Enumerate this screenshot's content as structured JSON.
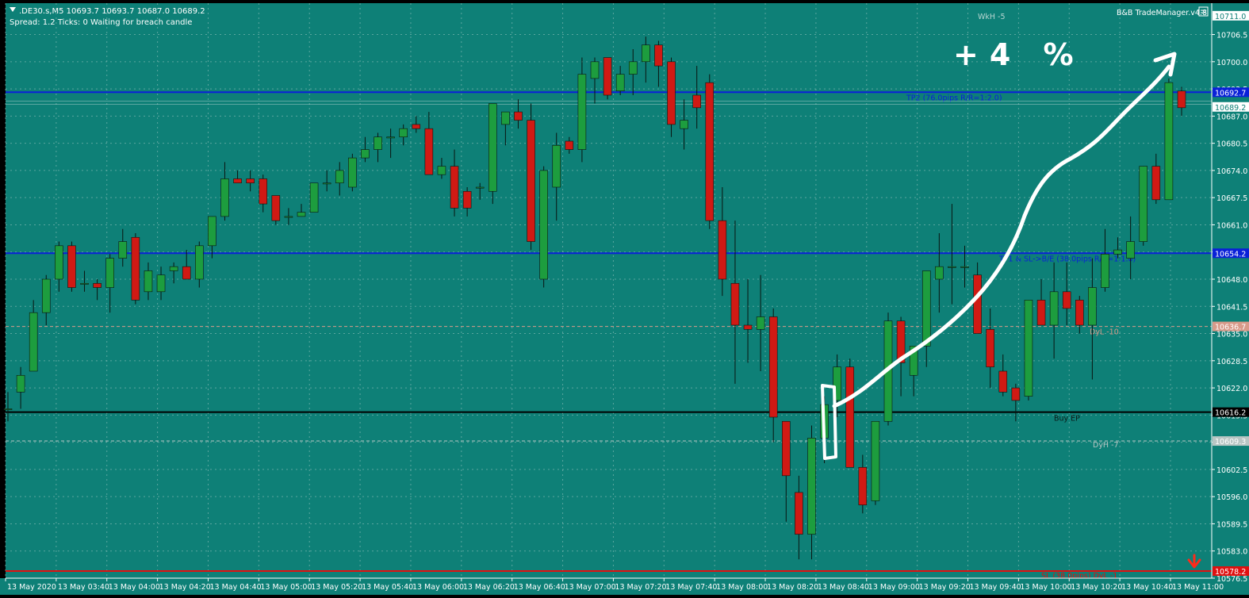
{
  "header": {
    "symbol_line": ".DE30.s,M5  10693.7 10693.7 10687.0 10689.2",
    "status_line": "Spread: 1.2  Ticks: 0  Waiting for breach candle",
    "trade_manager": "B&B TradeManager.v4.8"
  },
  "annotation": {
    "handwritten_text": "+4 %"
  },
  "colors": {
    "background": "#0e8077",
    "bull_body": "#1d9d3e",
    "bear_body": "#d01a14",
    "wick": "#0a1410",
    "tp_line": "#0a20d8",
    "sl_line": "#e01010",
    "entry_line": "#000000",
    "dyl_line": "#d89a8a",
    "dyh_line": "#b8c6c4",
    "grid": "#6fb0aa",
    "axis_text": "#ffffff"
  },
  "chart_data": {
    "type": "candlestick",
    "symbol": ".DE30.s",
    "timeframe": "M5",
    "ylim": [
      10576.5,
      10714
    ],
    "y_ticks": [
      "10706.5",
      "10700.0",
      "10693.5",
      "10687.0",
      "10680.5",
      "10674.0",
      "10667.5",
      "10661.0",
      "10654.5",
      "10648.0",
      "10641.5",
      "10635.0",
      "10628.5",
      "10622.0",
      "10615.5",
      "10609.0",
      "10602.5",
      "10596.0",
      "10589.5",
      "10583.0",
      "10576.5"
    ],
    "x_ticks": [
      "13 May 2020",
      "13 May 03:40",
      "13 May 04:00",
      "13 May 04:20",
      "13 May 04:40",
      "13 May 05:00",
      "13 May 05:20",
      "13 May 05:40",
      "13 May 06:00",
      "13 May 06:20",
      "13 May 06:40",
      "13 May 07:00",
      "13 May 07:20",
      "13 May 07:40",
      "13 May 08:00",
      "13 May 08:20",
      "13 May 08:40",
      "13 May 09:00",
      "13 May 09:20",
      "13 May 09:40",
      "13 May 10:00",
      "13 May 10:20",
      "13 May 10:40",
      "13 May 11:00"
    ],
    "price_tags": [
      {
        "value": "10711.0",
        "price": 10711.0,
        "color": "#ffffff",
        "text_color": "#0e8077"
      },
      {
        "value": "10692.7",
        "price": 10692.7,
        "color": "#0a20d8",
        "text_color": "#ffffff"
      },
      {
        "value": "10689.2",
        "price": 10689.2,
        "color": "#ffffff",
        "text_color": "#0e8077"
      },
      {
        "value": "10654.2",
        "price": 10654.2,
        "color": "#0a20d8",
        "text_color": "#ffffff"
      },
      {
        "value": "10636.7",
        "price": 10636.7,
        "color": "#d89a8a",
        "text_color": "#ffffff"
      },
      {
        "value": "10616.2",
        "price": 10616.2,
        "color": "#000000",
        "text_color": "#ffffff"
      },
      {
        "value": "10609.3",
        "price": 10609.3,
        "color": "#b8c6c4",
        "text_color": "#ffffff"
      },
      {
        "value": "10578.2",
        "price": 10578.2,
        "color": "#e01010",
        "text_color": "#ffffff"
      }
    ],
    "levels": [
      {
        "name": "tp2",
        "price": 10692.7,
        "style": "solid",
        "color": "#0a20d8",
        "label": "TP2 (76.0pips R/R=1:2.0)"
      },
      {
        "name": "tp1",
        "price": 10654.2,
        "style": "solid",
        "color": "#0a20d8",
        "label": "TP1 & SL->B/E (38.0pips R/R=1:1.0)"
      },
      {
        "name": "dyl",
        "price": 10636.7,
        "style": "dashed",
        "color": "#d89a8a",
        "label": "DyL -10"
      },
      {
        "name": "entry",
        "price": 10616.2,
        "style": "solid",
        "color": "#000000",
        "label": "Buy EP"
      },
      {
        "name": "dyh",
        "price": 10609.3,
        "style": "dashed",
        "color": "#b8c6c4",
        "label": "DyH -7"
      },
      {
        "name": "sl",
        "price": 10578.2,
        "style": "solid",
        "color": "#e01010",
        "label": "SL (38.0pips) DyL -1"
      },
      {
        "name": "wkh",
        "price": 10711.0,
        "style": "none",
        "color": "#b8d6d2",
        "label": "WkH -5"
      }
    ],
    "candles": [
      {
        "o": 10617,
        "h": 10621,
        "l": 10614,
        "c": 10617
      },
      {
        "o": 10621,
        "h": 10627,
        "l": 10617,
        "c": 10625
      },
      {
        "o": 10626,
        "h": 10643,
        "l": 10626,
        "c": 10640
      },
      {
        "o": 10640,
        "h": 10649,
        "l": 10637,
        "c": 10648
      },
      {
        "o": 10648,
        "h": 10657,
        "l": 10645,
        "c": 10656
      },
      {
        "o": 10656,
        "h": 10657,
        "l": 10645,
        "c": 10646
      },
      {
        "o": 10647,
        "h": 10650,
        "l": 10645,
        "c": 10647
      },
      {
        "o": 10647,
        "h": 10648,
        "l": 10643,
        "c": 10646
      },
      {
        "o": 10646,
        "h": 10654,
        "l": 10640,
        "c": 10653
      },
      {
        "o": 10653,
        "h": 10660,
        "l": 10651,
        "c": 10657
      },
      {
        "o": 10658,
        "h": 10659,
        "l": 10642,
        "c": 10643
      },
      {
        "o": 10645,
        "h": 10652,
        "l": 10643,
        "c": 10650
      },
      {
        "o": 10645,
        "h": 10651,
        "l": 10643,
        "c": 10649
      },
      {
        "o": 10650,
        "h": 10652,
        "l": 10647,
        "c": 10651
      },
      {
        "o": 10651,
        "h": 10655,
        "l": 10649,
        "c": 10648
      },
      {
        "o": 10648,
        "h": 10657,
        "l": 10646,
        "c": 10656
      },
      {
        "o": 10656,
        "h": 10663,
        "l": 10653,
        "c": 10663
      },
      {
        "o": 10663,
        "h": 10676,
        "l": 10662,
        "c": 10672
      },
      {
        "o": 10672,
        "h": 10674,
        "l": 10671,
        "c": 10671
      },
      {
        "o": 10672,
        "h": 10674,
        "l": 10669,
        "c": 10671
      },
      {
        "o": 10672,
        "h": 10673,
        "l": 10664,
        "c": 10666
      },
      {
        "o": 10668,
        "h": 10668,
        "l": 10661,
        "c": 10662
      },
      {
        "o": 10663,
        "h": 10665,
        "l": 10661,
        "c": 10663
      },
      {
        "o": 10663,
        "h": 10666,
        "l": 10663,
        "c": 10664
      },
      {
        "o": 10664,
        "h": 10671,
        "l": 10664,
        "c": 10671
      },
      {
        "o": 10671,
        "h": 10674,
        "l": 10669,
        "c": 10671
      },
      {
        "o": 10671,
        "h": 10676,
        "l": 10668,
        "c": 10674
      },
      {
        "o": 10670,
        "h": 10678,
        "l": 10669,
        "c": 10677
      },
      {
        "o": 10677,
        "h": 10682,
        "l": 10676,
        "c": 10679
      },
      {
        "o": 10679,
        "h": 10683,
        "l": 10676,
        "c": 10682
      },
      {
        "o": 10682,
        "h": 10684,
        "l": 10677,
        "c": 10682
      },
      {
        "o": 10682,
        "h": 10685,
        "l": 10680,
        "c": 10684
      },
      {
        "o": 10685,
        "h": 10687,
        "l": 10683,
        "c": 10684
      },
      {
        "o": 10684,
        "h": 10688,
        "l": 10673,
        "c": 10673
      },
      {
        "o": 10673,
        "h": 10677,
        "l": 10672,
        "c": 10675
      },
      {
        "o": 10675,
        "h": 10679,
        "l": 10663,
        "c": 10665
      },
      {
        "o": 10669,
        "h": 10670,
        "l": 10663,
        "c": 10665
      },
      {
        "o": 10670,
        "h": 10671,
        "l": 10667,
        "c": 10670
      },
      {
        "o": 10669,
        "h": 10690,
        "l": 10666,
        "c": 10690
      },
      {
        "o": 10685,
        "h": 10688,
        "l": 10680,
        "c": 10688
      },
      {
        "o": 10688,
        "h": 10691,
        "l": 10684,
        "c": 10686
      },
      {
        "o": 10686,
        "h": 10690,
        "l": 10655,
        "c": 10657
      },
      {
        "o": 10648,
        "h": 10675,
        "l": 10646,
        "c": 10674
      },
      {
        "o": 10670,
        "h": 10683,
        "l": 10662,
        "c": 10680
      },
      {
        "o": 10681,
        "h": 10682,
        "l": 10678,
        "c": 10679
      },
      {
        "o": 10679,
        "h": 10701,
        "l": 10676,
        "c": 10697
      },
      {
        "o": 10696,
        "h": 10701,
        "l": 10690,
        "c": 10700
      },
      {
        "o": 10701,
        "h": 10701,
        "l": 10691,
        "c": 10692
      },
      {
        "o": 10693,
        "h": 10699,
        "l": 10692,
        "c": 10697
      },
      {
        "o": 10697,
        "h": 10703,
        "l": 10692,
        "c": 10700
      },
      {
        "o": 10700,
        "h": 10706,
        "l": 10695,
        "c": 10704
      },
      {
        "o": 10704,
        "h": 10705,
        "l": 10694,
        "c": 10699
      },
      {
        "o": 10700,
        "h": 10701,
        "l": 10682,
        "c": 10685
      },
      {
        "o": 10684,
        "h": 10691,
        "l": 10679,
        "c": 10686
      },
      {
        "o": 10692,
        "h": 10699,
        "l": 10684,
        "c": 10689
      },
      {
        "o": 10695,
        "h": 10697,
        "l": 10660,
        "c": 10662
      },
      {
        "o": 10662,
        "h": 10670,
        "l": 10644,
        "c": 10648
      },
      {
        "o": 10647,
        "h": 10662,
        "l": 10623,
        "c": 10637
      },
      {
        "o": 10637,
        "h": 10648,
        "l": 10628,
        "c": 10636
      },
      {
        "o": 10636,
        "h": 10649,
        "l": 10626,
        "c": 10639
      },
      {
        "o": 10639,
        "h": 10641,
        "l": 10609,
        "c": 10615
      },
      {
        "o": 10614,
        "h": 10614,
        "l": 10590,
        "c": 10601
      },
      {
        "o": 10597,
        "h": 10601,
        "l": 10581,
        "c": 10587
      },
      {
        "o": 10587,
        "h": 10613,
        "l": 10581,
        "c": 10610
      },
      {
        "o": 10610,
        "h": 10620,
        "l": 10604,
        "c": 10618
      },
      {
        "o": 10619,
        "h": 10630,
        "l": 10615,
        "c": 10627
      },
      {
        "o": 10627,
        "h": 10629,
        "l": 10603,
        "c": 10603
      },
      {
        "o": 10603,
        "h": 10606,
        "l": 10592,
        "c": 10594
      },
      {
        "o": 10595,
        "h": 10614,
        "l": 10594,
        "c": 10614
      },
      {
        "o": 10614,
        "h": 10640,
        "l": 10613,
        "c": 10638
      },
      {
        "o": 10638,
        "h": 10639,
        "l": 10620,
        "c": 10628
      },
      {
        "o": 10625,
        "h": 10632,
        "l": 10620,
        "c": 10632
      },
      {
        "o": 10632,
        "h": 10650,
        "l": 10627,
        "c": 10650
      },
      {
        "o": 10648,
        "h": 10659,
        "l": 10640,
        "c": 10651
      },
      {
        "o": 10651,
        "h": 10666,
        "l": 10642,
        "c": 10651
      },
      {
        "o": 10651,
        "h": 10656,
        "l": 10646,
        "c": 10651
      },
      {
        "o": 10649,
        "h": 10652,
        "l": 10635,
        "c": 10635
      },
      {
        "o": 10636,
        "h": 10641,
        "l": 10622,
        "c": 10627
      },
      {
        "o": 10626,
        "h": 10630,
        "l": 10620,
        "c": 10621
      },
      {
        "o": 10622,
        "h": 10623,
        "l": 10614,
        "c": 10619
      },
      {
        "o": 10620,
        "h": 10643,
        "l": 10619,
        "c": 10643
      },
      {
        "o": 10643,
        "h": 10648,
        "l": 10637,
        "c": 10637
      },
      {
        "o": 10637,
        "h": 10652,
        "l": 10629,
        "c": 10645
      },
      {
        "o": 10645,
        "h": 10652,
        "l": 10637,
        "c": 10641
      },
      {
        "o": 10643,
        "h": 10644,
        "l": 10635,
        "c": 10637
      },
      {
        "o": 10637,
        "h": 10653,
        "l": 10624,
        "c": 10646
      },
      {
        "o": 10646,
        "h": 10660,
        "l": 10645,
        "c": 10654
      },
      {
        "o": 10654,
        "h": 10658,
        "l": 10653,
        "c": 10655
      },
      {
        "o": 10653,
        "h": 10663,
        "l": 10648,
        "c": 10657
      },
      {
        "o": 10657,
        "h": 10675,
        "l": 10656,
        "c": 10675
      },
      {
        "o": 10675,
        "h": 10678,
        "l": 10666,
        "c": 10667
      },
      {
        "o": 10667,
        "h": 10696,
        "l": 10667,
        "c": 10695
      },
      {
        "o": 10693,
        "h": 10694,
        "l": 10687,
        "c": 10689
      }
    ]
  }
}
